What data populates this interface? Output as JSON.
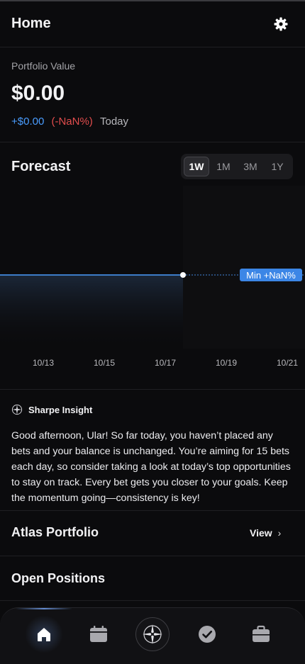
{
  "header": {
    "title": "Home",
    "settings_icon": "gear-icon"
  },
  "portfolio": {
    "label": "Portfolio Value",
    "value": "$0.00",
    "change_amount": "+$0.00",
    "change_percent": "(-NaN%)",
    "change_period": "Today"
  },
  "forecast": {
    "title": "Forecast",
    "ranges": [
      "1W",
      "1M",
      "3M",
      "1Y"
    ],
    "selected_range": "1W"
  },
  "chart_data": {
    "type": "line",
    "categories": [
      "10/13",
      "10/15",
      "10/17",
      "10/19",
      "10/21"
    ],
    "series": [
      {
        "values": [
          0,
          0,
          0,
          null,
          null
        ]
      }
    ],
    "projection_label": "Min +NaN%",
    "colors": {
      "line": "#4a9dff",
      "badge": "#3c86e6"
    }
  },
  "insight": {
    "title": "Sharpe Insight",
    "text": "Good afternoon, Ular! So far today, you haven’t placed any bets and your balance is unchanged. You’re aiming for 15 bets each day, so consider taking a look at today’s top opportunities to stay on track. Every bet gets you closer to your goals. Keep the momentum going—consistency is key!"
  },
  "atlas": {
    "title": "Atlas Portfolio",
    "view_label": "View",
    "chevron": "›"
  },
  "open_positions": {
    "title": "Open Positions"
  },
  "tabbar": {
    "items": [
      "home-icon",
      "calendar-icon",
      "compass-icon",
      "check-circle-icon",
      "briefcase-icon"
    ],
    "active": "home-icon"
  }
}
